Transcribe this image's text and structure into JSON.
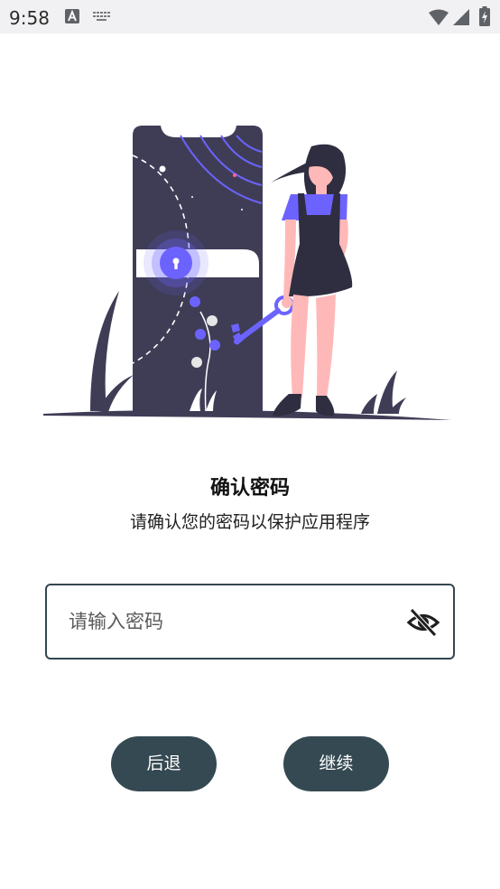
{
  "status_bar": {
    "time": "9:58",
    "icons": [
      "a-notification-icon",
      "keyboard-icon",
      "wifi-icon",
      "signal-icon",
      "battery-charging-icon"
    ]
  },
  "screen": {
    "title": "确认密码",
    "subtitle": "请确认您的密码以保护应用程序"
  },
  "password_field": {
    "value": "",
    "placeholder": "请输入密码",
    "visibility_icon": "eye-off-icon"
  },
  "buttons": {
    "back_label": "后退",
    "continue_label": "继续"
  },
  "colors": {
    "accent": "#6c63ff",
    "button_bg": "#354952",
    "field_border": "#33464f",
    "phone_dark": "#3f3d56",
    "skin": "#ffb8b8"
  }
}
